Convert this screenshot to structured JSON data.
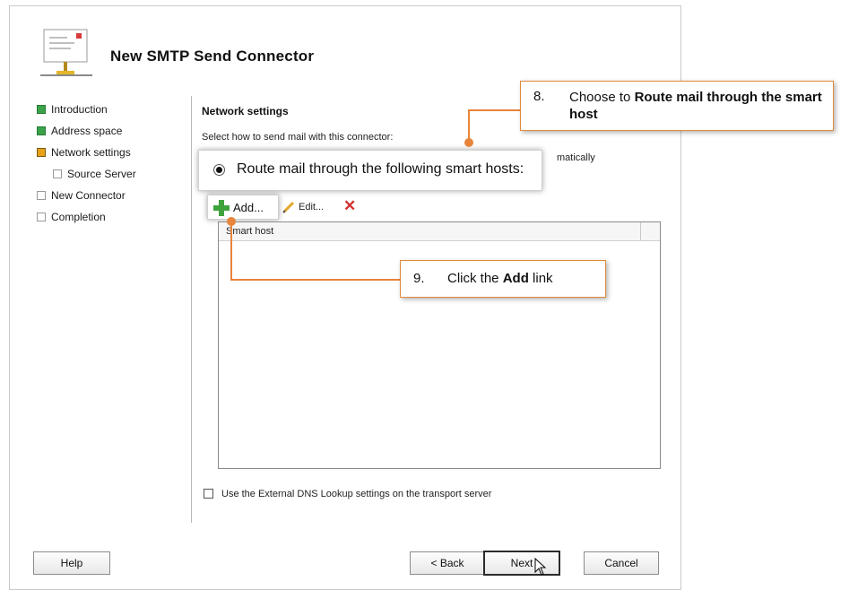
{
  "window": {
    "title": "New SMTP Send Connector"
  },
  "steps": [
    {
      "label": "Introduction",
      "state": "done"
    },
    {
      "label": "Address space",
      "state": "done"
    },
    {
      "label": "Network settings",
      "state": "current"
    },
    {
      "label": "Source Server",
      "state": "todo"
    },
    {
      "label": "New Connector",
      "state": "todo"
    },
    {
      "label": "Completion",
      "state": "todo"
    }
  ],
  "main": {
    "section_title": "Network settings",
    "prompt": "Select how to send mail with this connector:",
    "auto_partial": "matically",
    "radio_smart_hosts_label": "Route mail through the following smart hosts:",
    "toolbar": {
      "add_label": "Add...",
      "edit_label": "Edit..."
    },
    "table": {
      "column_header": "Smart host",
      "rows": []
    },
    "dns_checkbox_label": "Use the External DNS Lookup settings on the transport server"
  },
  "buttons": {
    "help": "Help",
    "back": "< Back",
    "next": "Next",
    "cancel": "Cancel"
  },
  "callouts": {
    "step8_number": "8.",
    "step8_text_prefix": "Choose to",
    "step8_text_bold": "Route mail through the smart host",
    "step9_number": "9.",
    "step9_text_prefix": "Click the",
    "step9_text_bold": "Add",
    "step9_text_suffix": "link"
  },
  "colors": {
    "accent_orange": "#e8843b",
    "done_green": "#3aa34a",
    "current_yellow": "#e7a21a",
    "delete_red": "#d43030"
  }
}
